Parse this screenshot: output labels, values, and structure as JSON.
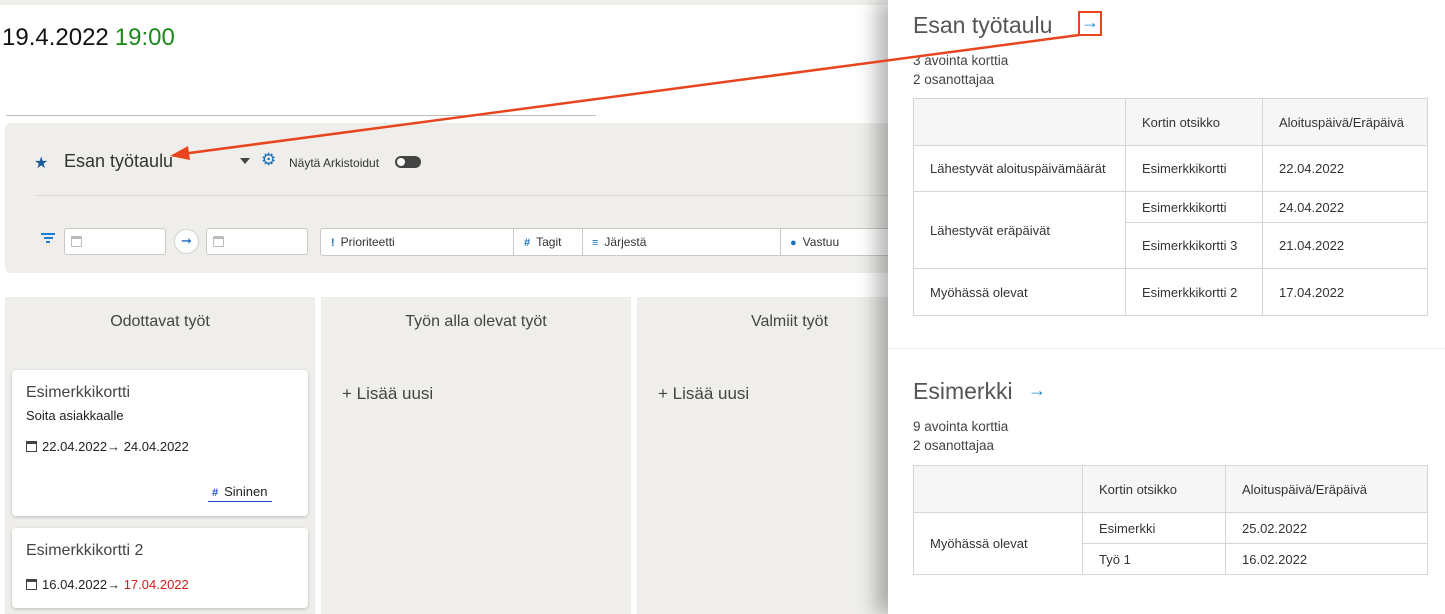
{
  "header": {
    "date": "19.4.2022",
    "time": "19:00"
  },
  "toolbar": {
    "board_name": "Esan työtaulu",
    "show_archived_label": "Näytä Arkistoidut",
    "filters": {
      "priority": "Prioriteetti",
      "tags": "Tagit",
      "sort": "Järjestä",
      "assignee": "Vastuu"
    }
  },
  "columns": [
    {
      "title": "Odottavat työt"
    },
    {
      "title": "Työn alla olevat työt",
      "add_label": "+ Lisää uusi"
    },
    {
      "title": "Valmiit työt",
      "add_label": "+ Lisää uusi"
    }
  ],
  "cards": [
    {
      "title": "Esimerkkikortti",
      "description": "Soita asiakkaalle",
      "start": "22.04.2022",
      "arrow": "→",
      "due": "24.04.2022",
      "tag": "Sininen"
    },
    {
      "title": "Esimerkkikortti 2",
      "start": "16.04.2022",
      "arrow": "→",
      "due": "17.04.2022",
      "due_overdue": true
    }
  ],
  "panel": {
    "boards": [
      {
        "title": "Esan työtaulu",
        "open_cards": "3 avointa korttia",
        "participants": "2 osanottajaa",
        "table": {
          "headers": [
            "",
            "Kortin otsikko",
            "Aloituspäivä/Eräpäivä"
          ],
          "groups": [
            {
              "label": "Lähestyvät aloituspäivämäärät",
              "rows": [
                [
                  "Esimerkkikortti",
                  "22.04.2022"
                ]
              ]
            },
            {
              "label": "Lähestyvät eräpäivät",
              "rows": [
                [
                  "Esimerkkikortti",
                  "24.04.2022"
                ],
                [
                  "Esimerkkikortti 3",
                  "21.04.2022"
                ]
              ]
            },
            {
              "label": "Myöhässä olevat",
              "rows": [
                [
                  "Esimerkkikortti 2",
                  "17.04.2022"
                ]
              ]
            }
          ]
        }
      },
      {
        "title": "Esimerkki",
        "open_cards": "9 avointa korttia",
        "participants": "2 osanottajaa",
        "table": {
          "headers": [
            "",
            "Kortin otsikko",
            "Aloituspäivä/Eräpäivä"
          ],
          "groups": [
            {
              "label": "Myöhässä olevat",
              "rows": [
                [
                  "Esimerkki",
                  "25.02.2022"
                ],
                [
                  "Työ 1",
                  "16.02.2022"
                ]
              ]
            }
          ]
        }
      }
    ]
  },
  "colors": {
    "accent": "#1b8ad6",
    "overdue": "#d01c1c",
    "time": "#1a8a1a",
    "annotation": "#e8451f"
  },
  "icons": [
    "star-icon",
    "caret-down-icon",
    "gear-icon",
    "filter-icon",
    "calendar-icon",
    "arrow-right-icon",
    "priority-icon",
    "hash-icon",
    "sort-icon",
    "person-icon"
  ]
}
